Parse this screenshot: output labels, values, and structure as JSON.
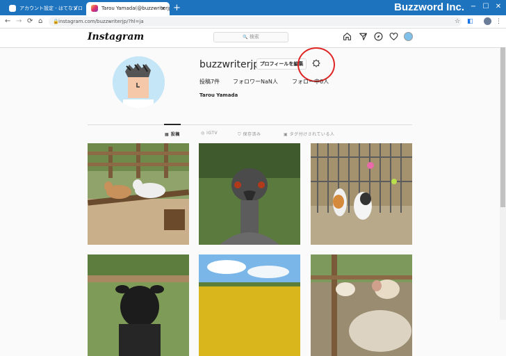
{
  "browser": {
    "tabs": [
      {
        "label": "アカウント設定 - はてなブログ",
        "active": false
      },
      {
        "label": "Tarou Yamada(@buzzwriterjp) •",
        "active": true
      }
    ],
    "new_tab": "+",
    "brand": "Buzzword Inc.",
    "url": "instagram.com/buzzwriterjp/?hl=ja",
    "window_controls": [
      "−",
      "☐",
      "✕"
    ]
  },
  "instagram": {
    "logo": "Instagram",
    "search_placeholder": "検索",
    "header_icons": [
      "home-icon",
      "direct-icon",
      "explore-icon",
      "activity-icon",
      "profile-avatar"
    ]
  },
  "profile": {
    "username": "buzzwriterjp",
    "edit_button": "プロフィールを編集",
    "posts": "投稿7件",
    "followers": "フォロワーNaN人",
    "following": "フォロー中0人",
    "full_name": "Tarou Yamada"
  },
  "profile_tabs": [
    {
      "label": "投稿",
      "icon": "grid-icon",
      "active": true
    },
    {
      "label": "IGTV",
      "icon": "igtv-icon",
      "active": false
    },
    {
      "label": "保存済み",
      "icon": "bookmark-icon",
      "active": false
    },
    {
      "label": "タグ付けされている人",
      "icon": "tagged-icon",
      "active": false
    }
  ],
  "colors": {
    "titlebar": "#1e73be",
    "annotation_circle": "#e02424"
  }
}
